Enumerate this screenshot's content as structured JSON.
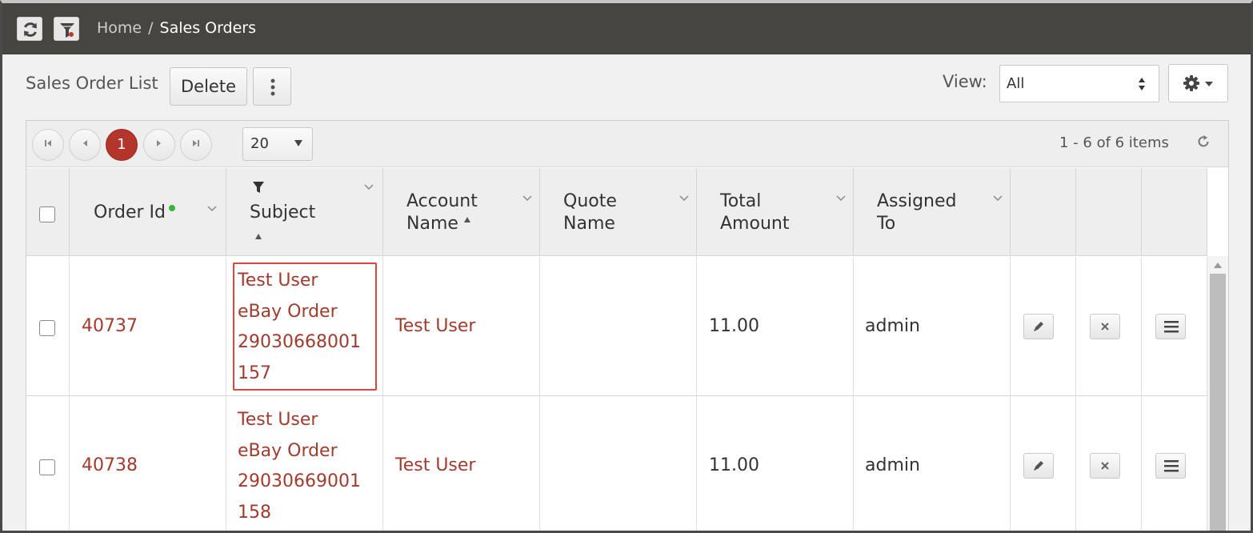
{
  "breadcrumb": {
    "home": "Home",
    "separator": "/",
    "current": "Sales Orders"
  },
  "toolbar": {
    "title": "Sales Order List",
    "delete_label": "Delete",
    "view_label": "View:",
    "view_value": "All"
  },
  "pager": {
    "current_page": "1",
    "page_size": "20",
    "items_info": "1 - 6 of 6 items"
  },
  "columns": {
    "order_id": "Order Id",
    "subject": "Subject",
    "account_name_1": "Account",
    "account_name_2": "Name",
    "quote_name_1": "Quote",
    "quote_name_2": "Name",
    "total_amount_1": "Total",
    "total_amount_2": "Amount",
    "assigned_to_1": "Assigned",
    "assigned_to_2": "To"
  },
  "rows": [
    {
      "order_id": "40737",
      "subject_lines": [
        "Test User",
        "eBay Order",
        "29030668001",
        "157"
      ],
      "account_name": "Test User",
      "quote_name": "",
      "total_amount": "11.00",
      "assigned_to": "admin"
    },
    {
      "order_id": "40738",
      "subject_lines": [
        "Test User",
        "eBay Order",
        "29030669001",
        "158"
      ],
      "account_name": "Test User",
      "quote_name": "",
      "total_amount": "11.00",
      "assigned_to": "admin"
    }
  ],
  "colors": {
    "link": "#a23b2d",
    "topbar": "#474542",
    "active_page": "#b3352b",
    "highlight": "#d9473f"
  }
}
